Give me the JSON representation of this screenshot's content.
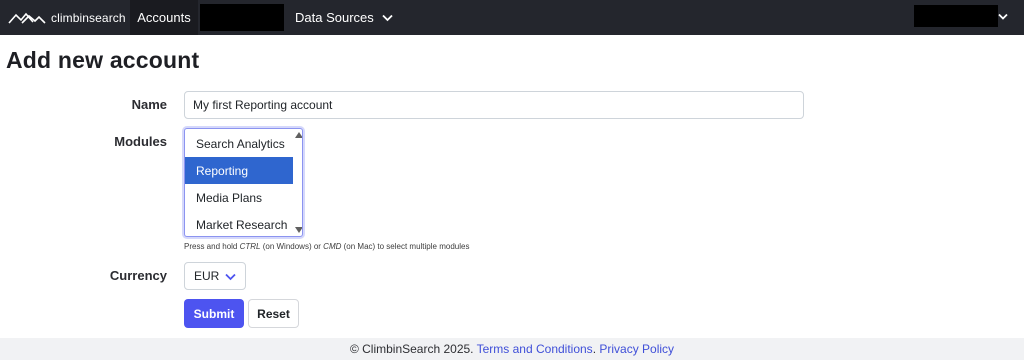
{
  "navbar": {
    "brand": "climbinsearch",
    "accounts_label": "Accounts",
    "data_sources_label": "Data Sources"
  },
  "page": {
    "title": "Add new account"
  },
  "form": {
    "name_label": "Name",
    "name_value": "My first Reporting account",
    "modules_label": "Modules",
    "modules_options": [
      "Search Analytics",
      "Reporting",
      "Media Plans",
      "Market Research"
    ],
    "modules_selected": "Reporting",
    "modules_help": {
      "part1": "Press and hold ",
      "ctrl": "CTRL",
      "part2": " (on Windows) or ",
      "cmd": "CMD",
      "part3": " (on Mac) to select multiple modules"
    },
    "currency_label": "Currency",
    "currency_value": "EUR",
    "submit_label": "Submit",
    "reset_label": "Reset"
  },
  "footer": {
    "copyright": "© ClimbinSearch 2025. ",
    "terms_label": "Terms and Conditions",
    "separator": ". ",
    "privacy_label": "Privacy Policy"
  },
  "colors": {
    "navbar_bg": "#24262d",
    "primary": "#4d54f0",
    "selected_option": "#2f66cf",
    "link": "#3f4fd8"
  }
}
